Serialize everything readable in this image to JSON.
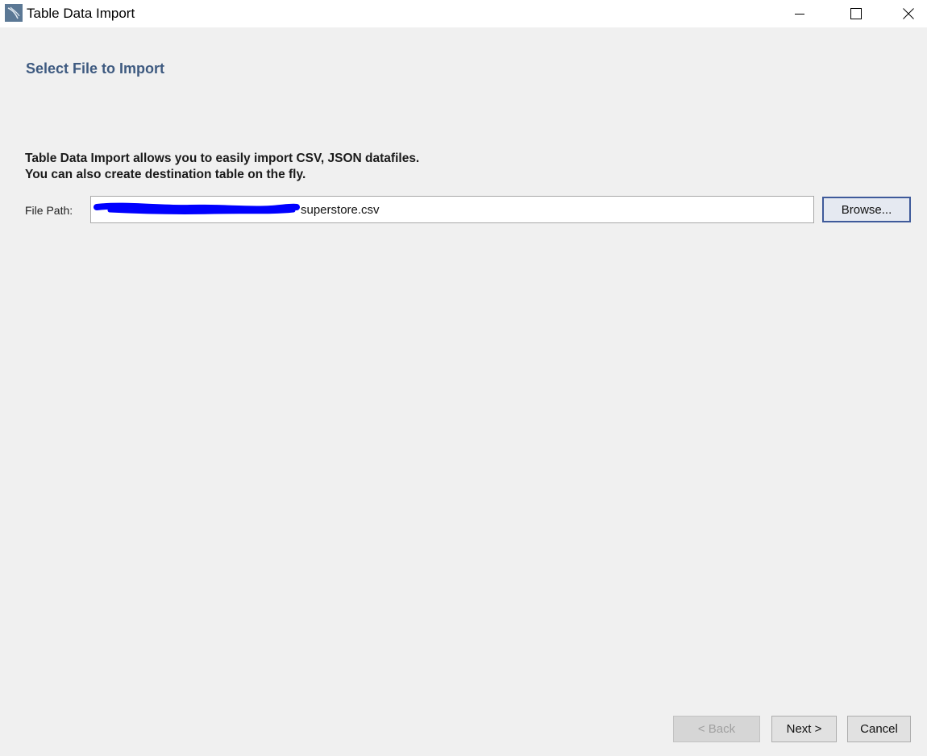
{
  "window": {
    "title": "Table Data Import",
    "icon": "mysql-workbench-icon",
    "controls": {
      "minimize": "minimize-icon",
      "maximize": "maximize-icon",
      "close": "close-icon"
    }
  },
  "page": {
    "heading": "Select File to Import",
    "description_line1": "Table Data Import allows you to easily import CSV, JSON datafiles.",
    "description_line2": "You can also create destination table on the fly."
  },
  "file_path": {
    "label": "File Path:",
    "value": "superstore.csv",
    "redacted_prefix": true
  },
  "buttons": {
    "browse": "Browse...",
    "back": "< Back",
    "next": "Next >",
    "cancel": "Cancel"
  },
  "colors": {
    "heading": "#3e5a80",
    "redaction": "#0000ff",
    "browse_focus_border": "#3f5a9a"
  }
}
